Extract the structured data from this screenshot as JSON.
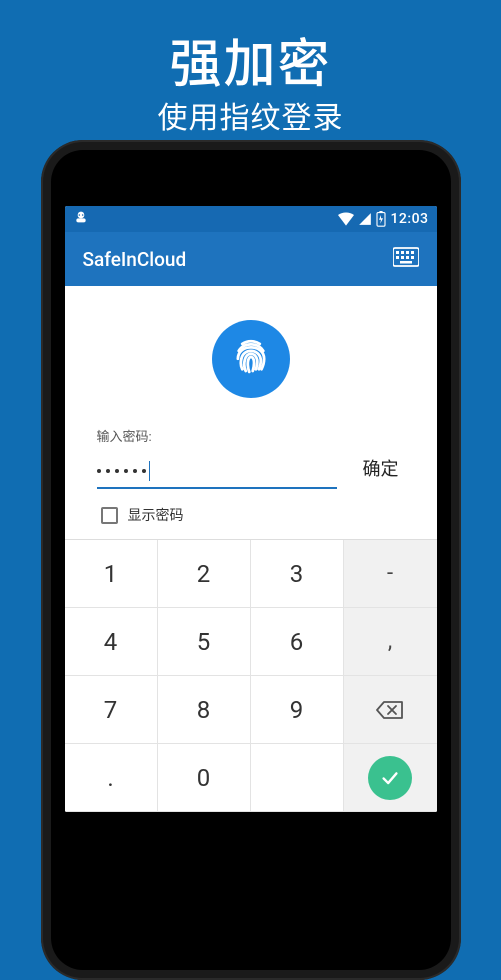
{
  "hero": {
    "title": "强加密",
    "subtitle": "使用指纹登录"
  },
  "statusbar": {
    "clock": "12:03"
  },
  "appbar": {
    "title": "SafeInCloud"
  },
  "login": {
    "password_label": "输入密码:",
    "password_dots": 6,
    "ok_label": "确定",
    "show_password_label": "显示密码",
    "show_password_checked": false
  },
  "keypad": {
    "rows": [
      [
        "1",
        "2",
        "3",
        "-"
      ],
      [
        "4",
        "5",
        "6",
        ","
      ],
      [
        "7",
        "8",
        "9",
        "backspace"
      ],
      [
        ".",
        "0",
        "",
        "done"
      ]
    ]
  }
}
